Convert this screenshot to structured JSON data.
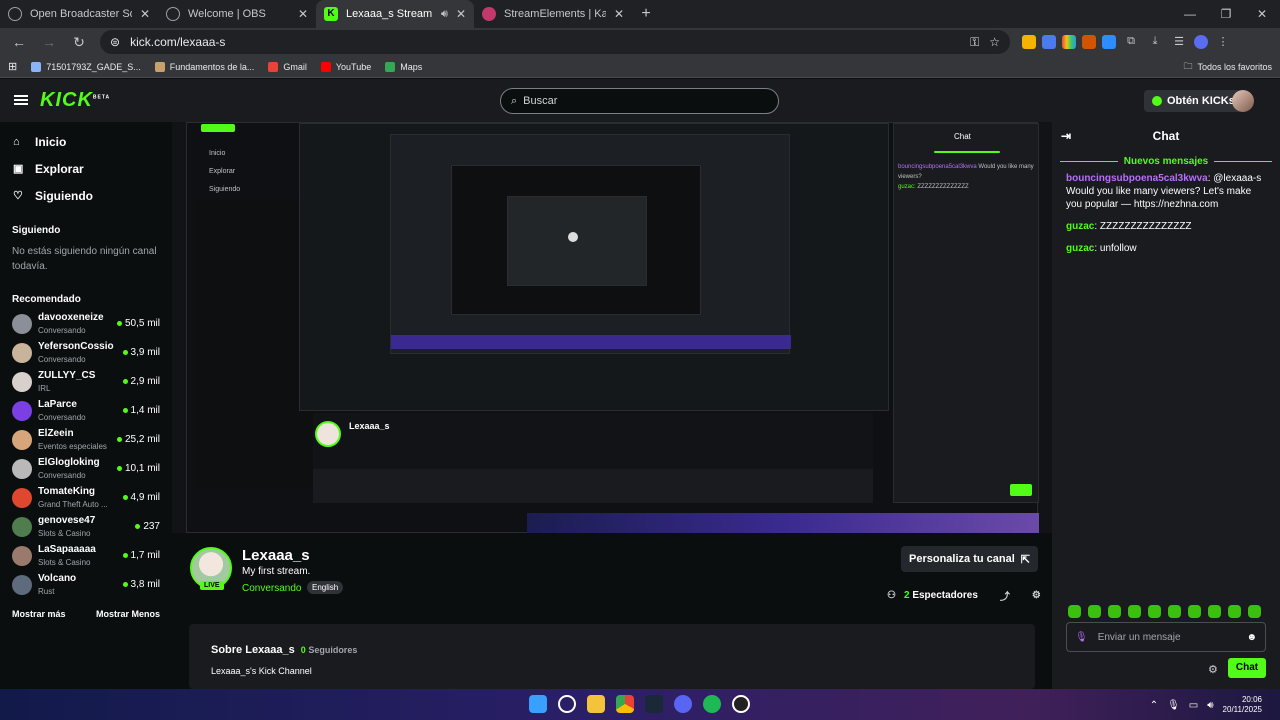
{
  "browser": {
    "tabs": [
      {
        "title": "Open Broadcaster Software | OBS",
        "active": false
      },
      {
        "title": "Welcome | OBS",
        "active": false
      },
      {
        "title": "Lexaaa_s Stream - Watch Live",
        "active": true
      },
      {
        "title": "StreamElements | Kawaii Alert Bo",
        "active": false
      }
    ],
    "url": "kick.com/lexaaa-s",
    "bookmarks": [
      "71501793Z_GADE_S...",
      "Fundamentos de la...",
      "Gmail",
      "YouTube",
      "Maps"
    ],
    "all_bookmarks": "Todos los favoritos"
  },
  "header": {
    "logo": "KICK",
    "logo_tag": "BETA",
    "search_placeholder": "Buscar",
    "kicks_button": "Obtén KICKs"
  },
  "sidebar": {
    "nav": [
      {
        "label": "Inicio",
        "icon": "home-icon",
        "glyph": "⌂"
      },
      {
        "label": "Explorar",
        "icon": "compass-icon",
        "glyph": "▣"
      },
      {
        "label": "Siguiendo",
        "icon": "heart-icon",
        "glyph": "♡"
      }
    ],
    "following_title": "Siguiendo",
    "following_empty": "No estás siguiendo ningún canal todavía.",
    "recommended_title": "Recomendado",
    "recommended": [
      {
        "name": "davooxeneize",
        "category": "Conversando",
        "viewers": "50,5 mil",
        "color": "#8a8f98"
      },
      {
        "name": "YefersonCossio",
        "category": "Conversando",
        "viewers": "3,9 mil",
        "color": "#c7b49a"
      },
      {
        "name": "ZULLYY_CS",
        "category": "IRL",
        "viewers": "2,9 mil",
        "color": "#d8d0cc"
      },
      {
        "name": "LaParce",
        "category": "Conversando",
        "viewers": "1,4 mil",
        "color": "#7b3fe4"
      },
      {
        "name": "ElZeein",
        "category": "Eventos especiales",
        "viewers": "25,2 mil",
        "color": "#d6a67a"
      },
      {
        "name": "ElGlogloking",
        "category": "Conversando",
        "viewers": "10,1 mil",
        "color": "#b9b9b9"
      },
      {
        "name": "TomateKing",
        "category": "Grand Theft Auto ...",
        "viewers": "4,9 mil",
        "color": "#e0472f"
      },
      {
        "name": "genovese47",
        "category": "Slots & Casino",
        "viewers": "237",
        "color": "#4f7d4e"
      },
      {
        "name": "LaSapaaaaa",
        "category": "Slots & Casino",
        "viewers": "1,7 mil",
        "color": "#9a7a6c"
      },
      {
        "name": "Volcano",
        "category": "Rust",
        "viewers": "3,8 mil",
        "color": "#5d6b7c"
      }
    ],
    "show_more": "Mostrar más",
    "show_less": "Mostrar Menos"
  },
  "channel": {
    "name": "Lexaaa_s",
    "title": "My first stream.",
    "category": "Conversando",
    "language": "English",
    "live_badge": "LIVE",
    "customize_button": "Personaliza tu canal",
    "viewers_count": "2",
    "viewers_label": "Espectadores",
    "about_title": "Sobre Lexaaa_s",
    "followers_count": "0",
    "followers_label": "Seguidores",
    "description": "Lexaaa_s's Kick Channel"
  },
  "chat": {
    "title": "Chat",
    "new_messages": "Nuevos mensajes",
    "messages": [
      {
        "user": "bouncingsubpoena5cal3kwva",
        "text": "@lexaaa-s Would you like many viewers? Let's make you popular — https://nezhna.com",
        "user_color": "#b96ff6"
      },
      {
        "user": "guzac",
        "text": "ZZZZZZZZZZZZZZZ",
        "user_color": "#53fc18"
      },
      {
        "user": "guzac",
        "text": "unfollow",
        "user_color": "#53fc18"
      }
    ],
    "input_placeholder": "Enviar un mensaje",
    "send_button": "Chat"
  },
  "taskbar": {
    "time": "20:06",
    "date": "20/11/2025"
  },
  "colors": {
    "accent": "#53fc18",
    "background": "#0b0e0f",
    "panel": "#191b1f"
  }
}
